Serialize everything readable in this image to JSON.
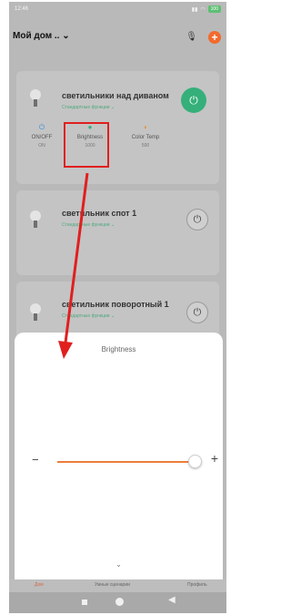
{
  "statusbar": {
    "time": "12:46",
    "battery": "100"
  },
  "header": {
    "title": "Мой дом .. ⌄"
  },
  "devices": [
    {
      "name": "светильники над диваном",
      "subtitle": "Стандартные функции ⌄",
      "functions": [
        {
          "label": "ON/OFF",
          "value": "ON"
        },
        {
          "label": "Brightness",
          "value": "1000"
        },
        {
          "label": "Color Temp",
          "value": "500"
        }
      ]
    },
    {
      "name": "светильник спот 1",
      "subtitle": "Стандартные функции ⌄"
    },
    {
      "name": "светильник поворотный 1",
      "subtitle": "Стандартные функции ⌄"
    }
  ],
  "sheet": {
    "title": "Brightness",
    "minus": "−",
    "plus": "+",
    "slider_fraction": 1.0
  },
  "tabs": [
    "Дом",
    "Умные сценарии",
    "Профиль"
  ],
  "colors": {
    "accent": "#f26a2e",
    "power_on": "#35b07a",
    "slider": "#ed7d3b",
    "annotation": "#e11f1f"
  },
  "icons": {
    "signal": "signal-icon",
    "wifi": "wifi-icon",
    "mic": "mic-icon",
    "add": "plus-icon",
    "bulb": "bulb-icon",
    "power": "power-icon",
    "chevron": "chevron-down-icon"
  }
}
